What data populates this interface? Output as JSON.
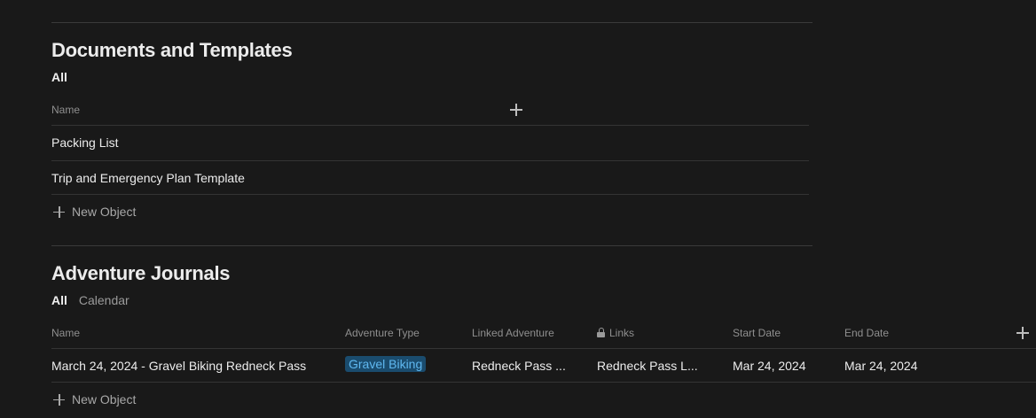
{
  "documents": {
    "title": "Documents and Templates",
    "views": [
      {
        "label": "All",
        "active": true
      }
    ],
    "columns": {
      "name": "Name"
    },
    "rows": [
      {
        "name": "Packing List"
      },
      {
        "name": "Trip and Emergency Plan Template"
      }
    ],
    "new_object_label": "New Object"
  },
  "journals": {
    "title": "Adventure Journals",
    "views": [
      {
        "label": "All",
        "active": true
      },
      {
        "label": "Calendar",
        "active": false
      }
    ],
    "columns": {
      "name": "Name",
      "adventure_type": "Adventure Type",
      "linked_adventure": "Linked Adventure",
      "links": "Links",
      "start_date": "Start Date",
      "end_date": "End Date"
    },
    "rows": [
      {
        "name": "March 24, 2024 - Gravel Biking Redneck Pass",
        "adventure_type": "Gravel Biking",
        "linked_adventure": "Redneck Pass ...",
        "links": "Redneck Pass L...",
        "start_date": "Mar 24, 2024",
        "end_date": "Mar 24, 2024"
      }
    ],
    "new_object_label": "New Object"
  },
  "colors": {
    "background": "#191919",
    "tag_bg": "#1a4c6e",
    "tag_text": "#5fb8f0"
  }
}
